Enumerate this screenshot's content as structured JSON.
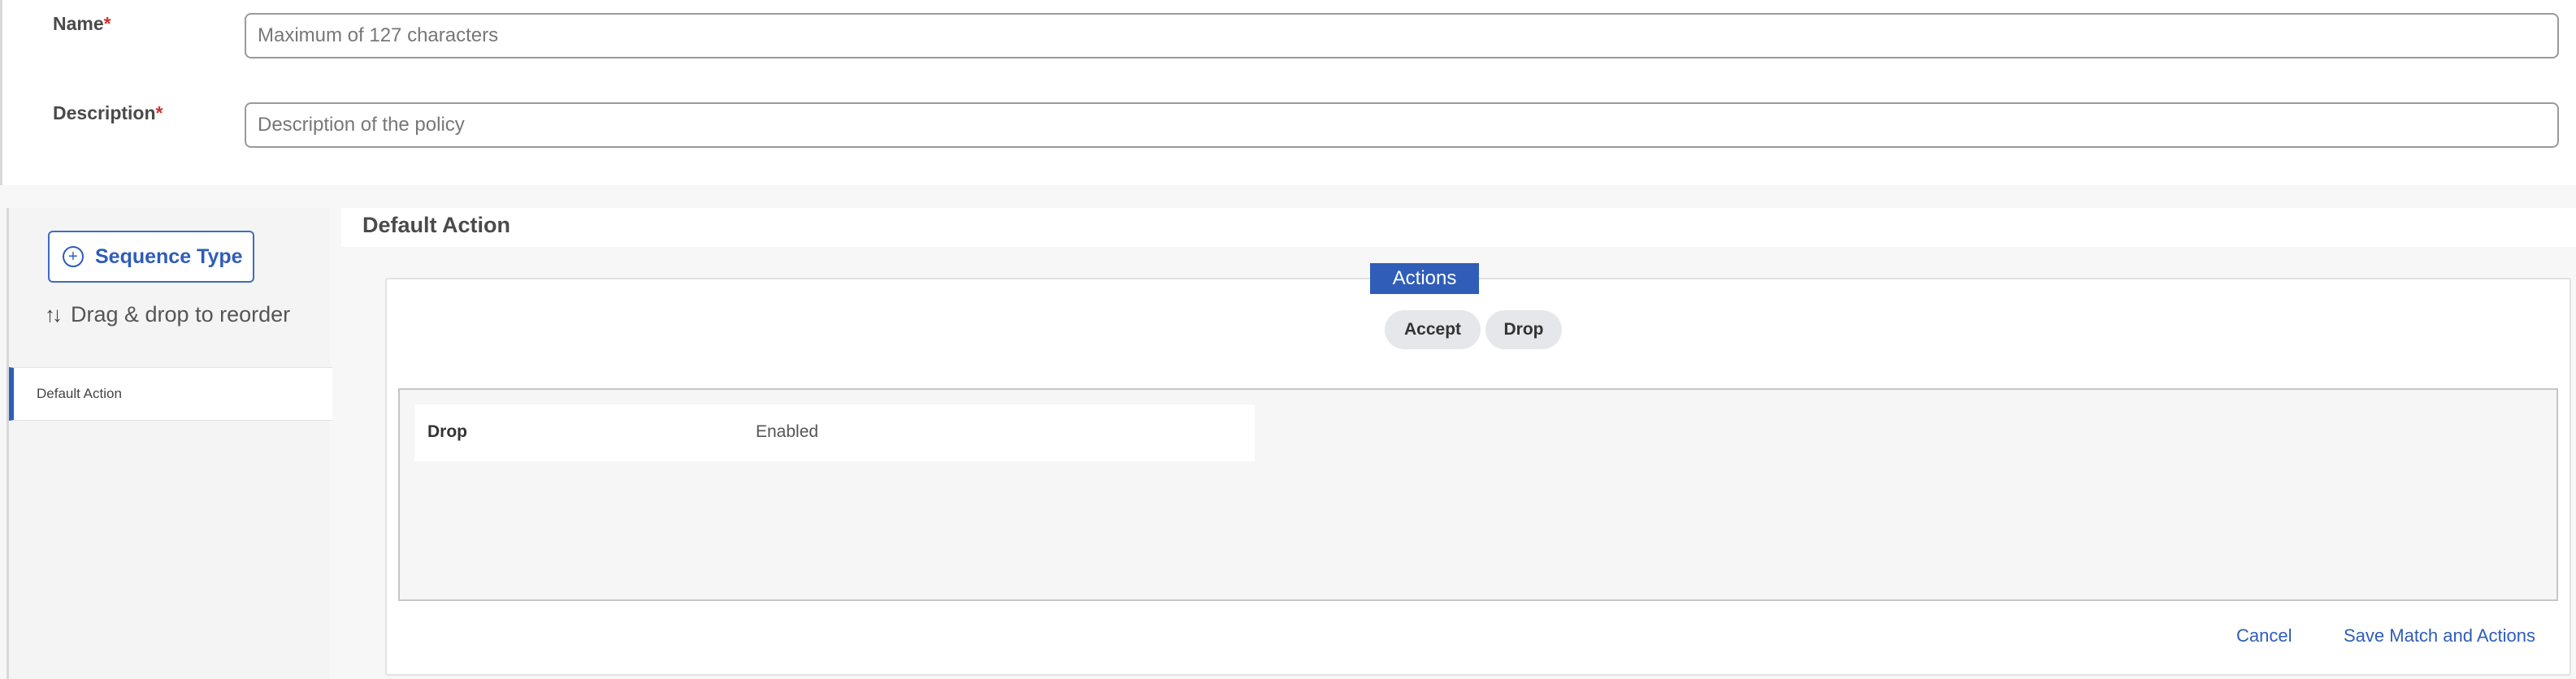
{
  "form": {
    "name_label": "Name",
    "name_required": "*",
    "name_value": "",
    "name_placeholder": "Maximum of 127 characters",
    "description_label": "Description",
    "description_required": "*",
    "description_value": "",
    "description_placeholder": "Description of the policy"
  },
  "sidebar": {
    "sequence_type_button": "Sequence Type",
    "sequence_type_icon": "plus-circle-icon",
    "drag_text": "Drag & drop to reorder",
    "drag_icon": "sort-arrows-icon",
    "items": [
      {
        "label": "Default Action",
        "selected": true
      }
    ]
  },
  "main": {
    "title": "Default Action",
    "actions_label": "Actions",
    "action_buttons": [
      "Accept",
      "Drop"
    ],
    "details": [
      {
        "key": "Drop",
        "value": "Enabled"
      }
    ],
    "cancel_label": "Cancel",
    "save_label": "Save Match and Actions"
  },
  "colors": {
    "accent": "#2f5db8",
    "required": "#d0312d",
    "pill_bg": "#e5e7ea"
  }
}
